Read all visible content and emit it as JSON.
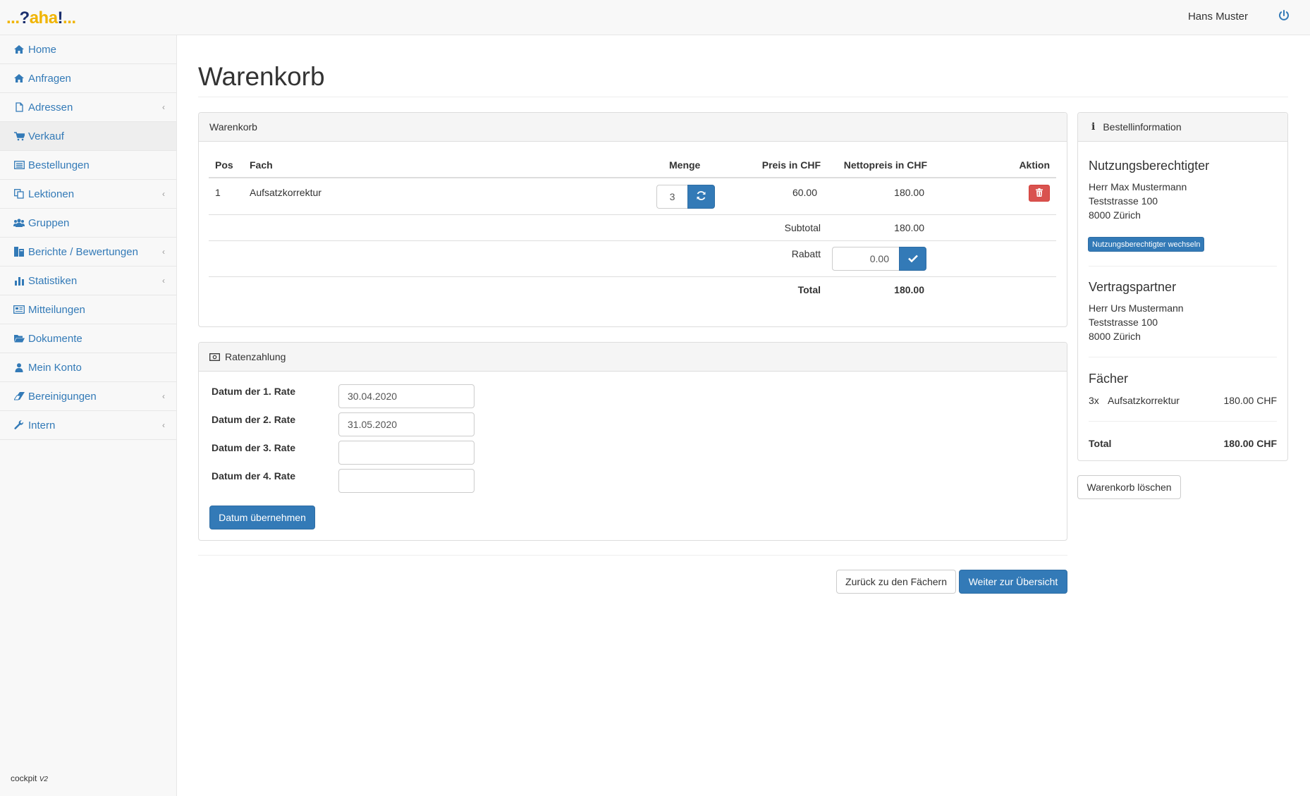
{
  "app": {
    "logo_text": "...?aha!...",
    "user_name": "Hans Muster"
  },
  "sidebar": {
    "items": [
      {
        "label": "Home",
        "icon": "home-icon",
        "has_children": false
      },
      {
        "label": "Anfragen",
        "icon": "home-icon",
        "has_children": false
      },
      {
        "label": "Adressen",
        "icon": "file-icon",
        "has_children": true
      },
      {
        "label": "Verkauf",
        "icon": "cart-icon",
        "has_children": false,
        "active": true
      },
      {
        "label": "Bestellungen",
        "icon": "list-icon",
        "has_children": false
      },
      {
        "label": "Lektionen",
        "icon": "copy-icon",
        "has_children": true
      },
      {
        "label": "Gruppen",
        "icon": "users-icon",
        "has_children": false
      },
      {
        "label": "Berichte / Bewertungen",
        "icon": "report-icon",
        "has_children": true
      },
      {
        "label": "Statistiken",
        "icon": "bar-chart-icon",
        "has_children": true
      },
      {
        "label": "Mitteilungen",
        "icon": "newspaper-icon",
        "has_children": false
      },
      {
        "label": "Dokumente",
        "icon": "folder-open-icon",
        "has_children": false
      },
      {
        "label": "Mein Konto",
        "icon": "user-icon",
        "has_children": false
      },
      {
        "label": "Bereinigungen",
        "icon": "eraser-icon",
        "has_children": true
      },
      {
        "label": "Intern",
        "icon": "wrench-icon",
        "has_children": true
      }
    ],
    "footer_text": "cockpit",
    "footer_version": "V2"
  },
  "main": {
    "title": "Warenkorb",
    "cart": {
      "heading": "Warenkorb",
      "columns": {
        "pos": "Pos",
        "fach": "Fach",
        "menge": "Menge",
        "preis": "Preis in CHF",
        "netto": "Nettopreis in CHF",
        "aktion": "Aktion"
      },
      "rows": [
        {
          "pos": "1",
          "fach": "Aufsatzkorrektur",
          "menge": "3",
          "preis": "60.00",
          "netto": "180.00"
        }
      ],
      "subtotal_label": "Subtotal",
      "subtotal_value": "180.00",
      "rabatt_label": "Rabatt",
      "rabatt_value": "0.00",
      "total_label": "Total",
      "total_value": "180.00"
    },
    "rates": {
      "heading": "Ratenzahlung",
      "items": [
        {
          "label": "Datum der 1. Rate",
          "value": "30.04.2020"
        },
        {
          "label": "Datum der 2. Rate",
          "value": "31.05.2020"
        },
        {
          "label": "Datum der 3. Rate",
          "value": ""
        },
        {
          "label": "Datum der 4. Rate",
          "value": ""
        }
      ],
      "apply_button": "Datum übernehmen"
    },
    "back_button": "Zurück zu den Fächern",
    "next_button": "Weiter zur Übersicht"
  },
  "info": {
    "heading": "Bestellinformation",
    "beneficiary": {
      "title": "Nutzungsberechtigter",
      "name": "Herr Max Mustermann",
      "street": "Teststrasse 100",
      "city": "8000 Zürich",
      "change_button": "Nutzungsberechtigter wechseln"
    },
    "partner": {
      "title": "Vertragspartner",
      "name": "Herr Urs Mustermann",
      "street": "Teststrasse 100",
      "city": "8000 Zürich"
    },
    "subjects": {
      "title": "Fächer",
      "items": [
        {
          "qty": "3x",
          "name": "Aufsatzkorrektur",
          "price": "180.00 CHF"
        }
      ]
    },
    "total_label": "Total",
    "total_value": "180.00 CHF",
    "clear_button": "Warenkorb löschen"
  },
  "colors": {
    "primary": "#337ab7",
    "danger": "#d9534f",
    "link": "#337ab7",
    "logo_yellow": "#f0b400",
    "logo_navy": "#1b2f6e"
  }
}
